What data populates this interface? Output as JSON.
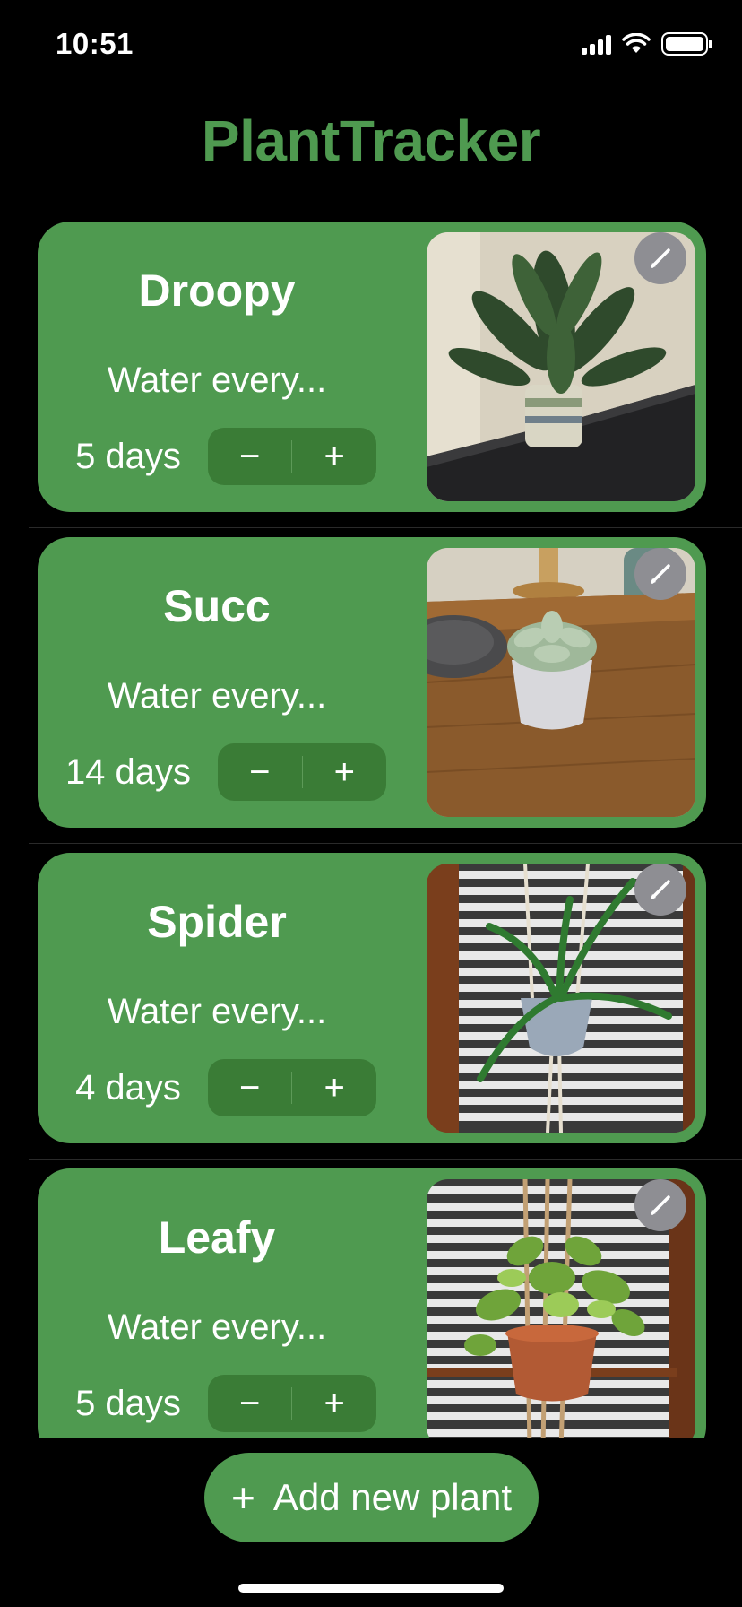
{
  "status_bar": {
    "time": "10:51"
  },
  "app": {
    "title": "PlantTracker"
  },
  "plants": [
    {
      "name": "Droopy",
      "water_label": "Water every...",
      "days": "5 days",
      "decrement": "−",
      "increment": "+",
      "photo_icon": "peace-lily-photo",
      "edit_icon": "pencil-icon"
    },
    {
      "name": "Succ",
      "water_label": "Water every...",
      "days": "14 days",
      "decrement": "−",
      "increment": "+",
      "photo_icon": "succulent-photo",
      "edit_icon": "pencil-icon"
    },
    {
      "name": "Spider",
      "water_label": "Water every...",
      "days": "4 days",
      "decrement": "−",
      "increment": "+",
      "photo_icon": "spider-plant-photo",
      "edit_icon": "pencil-icon"
    },
    {
      "name": "Leafy",
      "water_label": "Water every...",
      "days": "5 days",
      "decrement": "−",
      "increment": "+",
      "photo_icon": "pothos-photo",
      "edit_icon": "pencil-icon"
    }
  ],
  "add_button": {
    "icon": "+",
    "label": "Add new plant"
  },
  "colors": {
    "accent": "#4f9a50",
    "stepper": "#3a7c36",
    "background": "#000000",
    "edit_button": "#8e8e93"
  }
}
